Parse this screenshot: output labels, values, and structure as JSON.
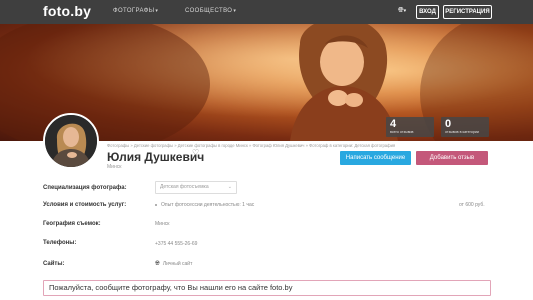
{
  "header": {
    "logo": "foto.by",
    "nav": [
      {
        "label": "ФОТОГРАФЫ"
      },
      {
        "label": "СООБЩЕСТВО"
      }
    ],
    "login_label": "ВХОД",
    "register_label": "РЕГИСТРАЦИЯ"
  },
  "stats": [
    {
      "value": "4",
      "label": "всего отзывов"
    },
    {
      "value": "0",
      "label": "отзывов в категории"
    }
  ],
  "profile": {
    "breadcrumb": "Фотографы » Детские фотографы » Детские фотографы в городе Минск » Фотограф Юлия Душкевич » Фотограф в категории: Детская фотография",
    "name": "Юлия Душкевич",
    "city": "Минск",
    "message_button": "Написать сообщение",
    "review_button": "Добавить отзыв"
  },
  "details": {
    "specialization_label": "Специализация фотографа:",
    "specialization_value": "Детская фотосъемка",
    "conditions_label": "Условия и стоимость услуг:",
    "conditions_value": "Опыт фотосессии деятельностью: 1 час",
    "price": "от 600 руб.",
    "geography_label": "География съемок:",
    "geography_value": "Минск",
    "phones_label": "Телефоны:",
    "phone": "+375 44 555-26-69",
    "sites_label": "Сайты:",
    "site": "Личный сайт"
  },
  "notice": "Пожалуйста, сообщите фотографу, что Вы нашли его на сайте foto.by",
  "colors": {
    "topbar": "#3f3f3f",
    "message_button": "#29a8e0",
    "review_button": "#c4587a",
    "notice_border": "#e2a5b8"
  }
}
